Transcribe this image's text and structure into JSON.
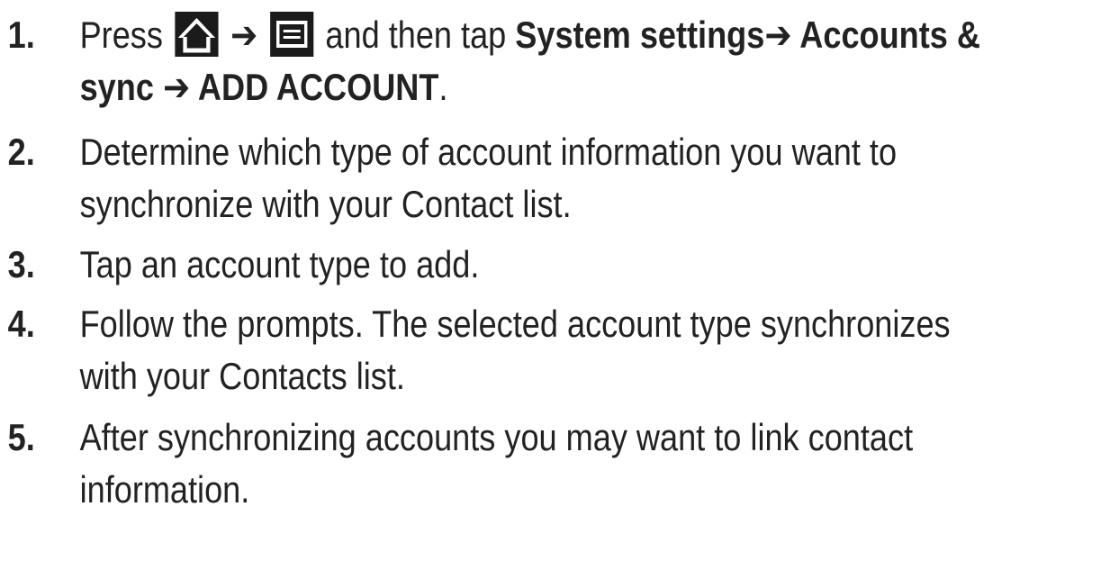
{
  "steps": [
    {
      "number": "1.",
      "line1": {
        "press": "Press ",
        "home_icon": "home-icon",
        "arrow1": " ➔ ",
        "menu_icon": "menu-icon",
        "then_tap": " and then tap ",
        "system_settings": "System settings",
        "arrow2": "➔ ",
        "accounts_amp": "Accounts &"
      },
      "line2": {
        "sync": "sync",
        "arrow3": " ➔ ",
        "add_account": "ADD ACCOUNT",
        "period": "."
      }
    },
    {
      "number": "2.",
      "lines": [
        "Determine which type of account information you want to",
        "synchronize with your Contact list."
      ]
    },
    {
      "number": "3.",
      "lines": [
        "Tap an account type to add."
      ]
    },
    {
      "number": "4.",
      "lines": [
        "Follow the prompts. The selected account type synchronizes",
        "with your Contacts list."
      ]
    },
    {
      "number": "5.",
      "lines": [
        "After synchronizing accounts you may want to link contact",
        "information."
      ]
    }
  ],
  "colors": {
    "text": "#222222",
    "icon_background": "#1b1b1b",
    "icon_foreground": "#ffffff"
  }
}
